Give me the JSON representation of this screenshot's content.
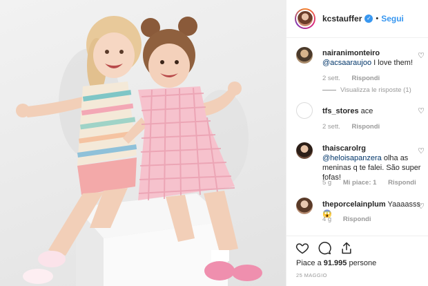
{
  "post": {
    "username": "kcstauffer",
    "verified_icon": "verified-badge-icon",
    "separator": "•",
    "follow_label": "Segui",
    "likes_prefix": "Piace a",
    "likes_count": "91.995",
    "likes_suffix": "persone",
    "date": "25 MAGGIO"
  },
  "comments": [
    {
      "user": "nairanimonteiro",
      "mention": "@acsaaraujoo",
      "text": " I love them!",
      "time": "2 sett.",
      "likes": "",
      "reply_label": "Rispondi",
      "view_replies": "Visualizza le risposte (1)"
    },
    {
      "user": "tfs_stores",
      "mention": "",
      "text": " ace",
      "time": "2 sett.",
      "likes": "",
      "reply_label": "Rispondi",
      "view_replies": ""
    },
    {
      "user": "thaiscarolrg",
      "mention": "@heloisapanzera",
      "text": " olha as meninas q te falei. São super fofas!",
      "time": "5 g",
      "likes": "Mi piace: 1",
      "reply_label": "Rispondi",
      "view_replies": ""
    },
    {
      "user": "theporcelainplum",
      "mention": "",
      "text": " Yaaaasss 😱",
      "time": "4 g",
      "likes": "",
      "reply_label": "Rispondi",
      "view_replies": ""
    }
  ],
  "icons": {
    "like": "heart-icon",
    "comment": "comment-icon",
    "share": "share-icon",
    "comment_like": "heart-icon"
  },
  "colors": {
    "accent": "#3897f0",
    "text": "#262626",
    "muted": "#999999",
    "mention": "#003569",
    "border": "#efefef"
  }
}
